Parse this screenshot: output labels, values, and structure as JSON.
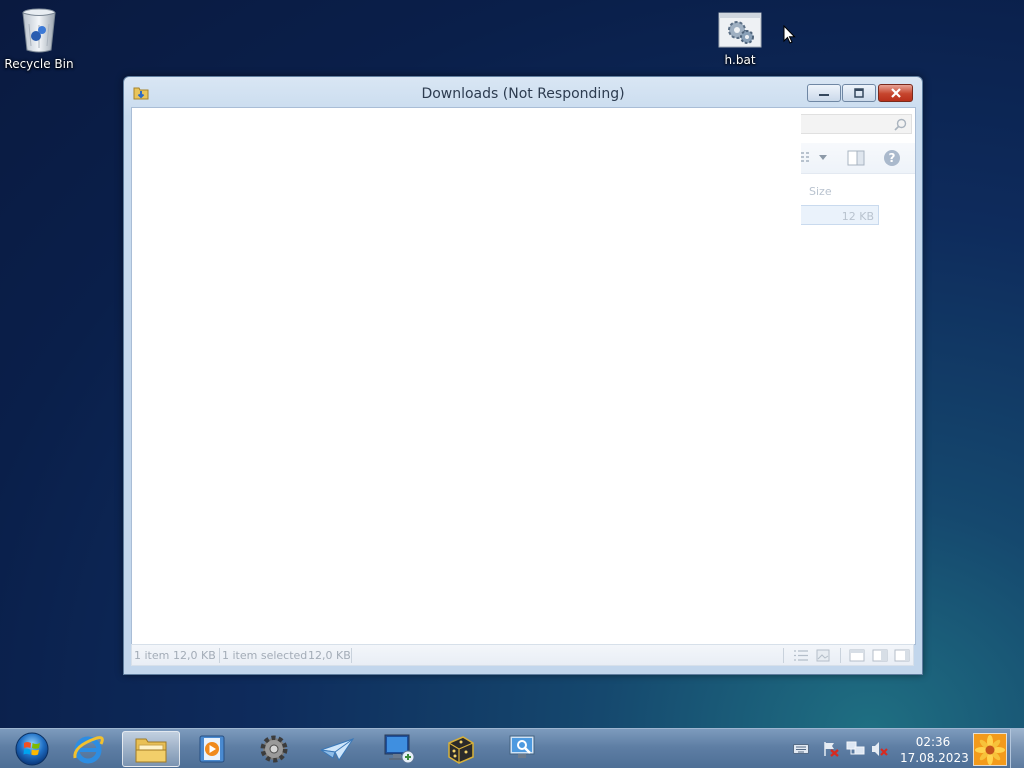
{
  "desktop": {
    "icons": [
      {
        "label": "Recycle Bin",
        "icon": "recycle-bin-icon"
      },
      {
        "label": "h.bat",
        "icon": "batch-file-icon"
      }
    ]
  },
  "window": {
    "title": "Downloads (Not Responding)",
    "icon": "downloads-folder-icon",
    "buttons": {
      "minimize": "minimize-icon",
      "maximize": "maximize-icon",
      "close": "close-icon"
    },
    "column_header_size": "Size",
    "row": {
      "size": "12 KB"
    },
    "statusbar": {
      "item_count": "1 item",
      "total_size": "12,0 KB",
      "selected": "1 item selected",
      "selected_size": "12,0 KB"
    }
  },
  "taskbar": {
    "items": [
      {
        "name": "start-button",
        "icon": "windows-orb-icon"
      },
      {
        "name": "internet-explorer",
        "icon": "ie-icon"
      },
      {
        "name": "windows-explorer",
        "icon": "folder-icon",
        "active": true
      },
      {
        "name": "media-player",
        "icon": "media-player-icon"
      },
      {
        "name": "settings-app",
        "icon": "gear-icon"
      },
      {
        "name": "paper-plane-app",
        "icon": "paper-plane-icon"
      },
      {
        "name": "remote-desktop",
        "icon": "remote-desktop-icon"
      },
      {
        "name": "dice-app",
        "icon": "dice-icon"
      },
      {
        "name": "network-monitor",
        "icon": "network-monitor-icon"
      }
    ],
    "tray": {
      "icons": [
        "keyboard-icon",
        "action-center-flag-icon",
        "network-icon",
        "volume-muted-icon"
      ],
      "time": "02:36",
      "date": "17.08.2023"
    }
  },
  "colors": {
    "desktop_bg": "#0e2b5c",
    "close_button": "#c6452d",
    "taskbar": "#5e7ea4"
  }
}
